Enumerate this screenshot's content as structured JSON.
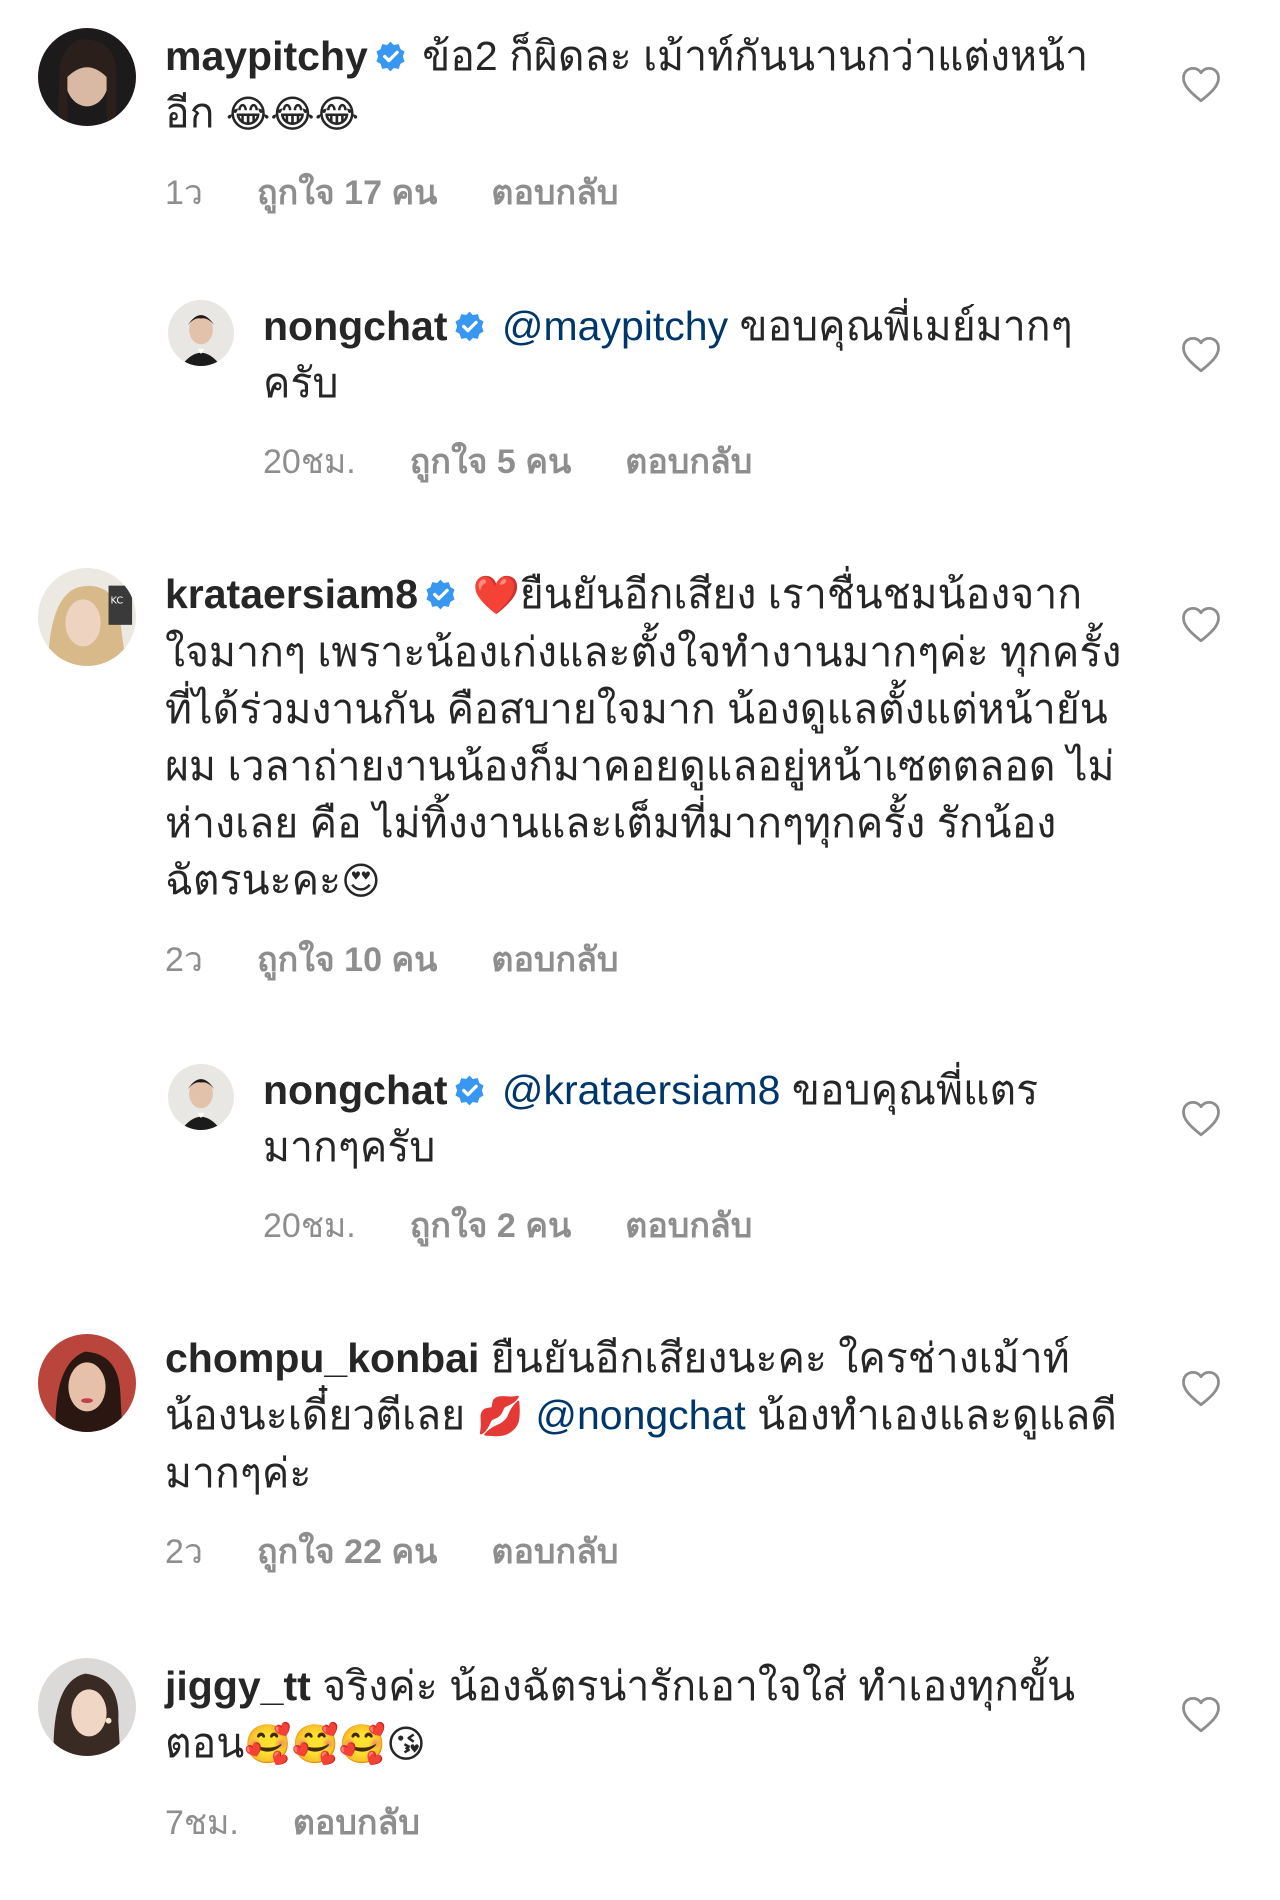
{
  "comments": [
    {
      "username": "maypitchy",
      "verified": true,
      "text": "ข้อ2 ก็ผิดละ เม้าท์กันนานกว่าแต่งหน้าอีก",
      "emoji": "😂😂😂",
      "time": "1ว",
      "likes": "ถูกใจ 17 คน",
      "reply": "ตอบกลับ"
    },
    {
      "username": "nongchat",
      "verified": true,
      "mention": "@maypitchy",
      "text": "ขอบคุณพี่เมย์มากๆครับ",
      "time": "20ชม.",
      "likes": "ถูกใจ 5 คน",
      "reply": "ตอบกลับ"
    },
    {
      "username": "krataersiam8",
      "verified": true,
      "emoji_lead": "❤️",
      "text": "ยืนยันอีกเสียง เราชื่นชมน้องจากใจมากๆ เพราะน้องเก่งและตั้งใจทำงานมากๆค่ะ ทุกครั้งที่ได้ร่วมงานกัน คือสบายใจมาก น้องดูแลตั้งแต่หน้ายันผม เวลาถ่ายงานน้องก็มาคอยดูแลอยู่หน้าเซตตลอด ไม่ห่างเลย คือ ไม่ทิ้งงานและเต็มที่มากๆทุกครั้ง รักน้องฉัตรนะคะ",
      "emoji": "😍",
      "time": "2ว",
      "likes": "ถูกใจ 10 คน",
      "reply": "ตอบกลับ"
    },
    {
      "username": "nongchat",
      "verified": true,
      "mention": "@krataersiam8",
      "text": "ขอบคุณพี่แตรมากๆครับ",
      "time": "20ชม.",
      "likes": "ถูกใจ 2 คน",
      "reply": "ตอบกลับ"
    },
    {
      "username": "chompu_konbai",
      "verified": false,
      "text": "ยืนยันอีกเสียงนะคะ ใครช่างเม้าท์น้องนะเดี๋ยวตีเลย",
      "emoji_mid": "💋",
      "mention": "@nongchat",
      "text2": "น้องทำเองและดูแลดีมากๆค่ะ",
      "time": "2ว",
      "likes": "ถูกใจ 22 คน",
      "reply": "ตอบกลับ"
    },
    {
      "username": "jiggy_tt",
      "verified": false,
      "text": "จริงค่ะ น้องฉัตรน่ารักเอาใจใส่ ทำเองทุกขั้นตอน",
      "emoji": "🥰🥰🥰😘",
      "time": "7ชม.",
      "reply": "ตอบกลับ"
    }
  ],
  "icons": {
    "verified": "verified-badge-icon",
    "heart": "heart-outline-icon"
  },
  "colors": {
    "verified": "#3897f0",
    "mention": "#00376b",
    "meta": "#8e8e8e"
  }
}
